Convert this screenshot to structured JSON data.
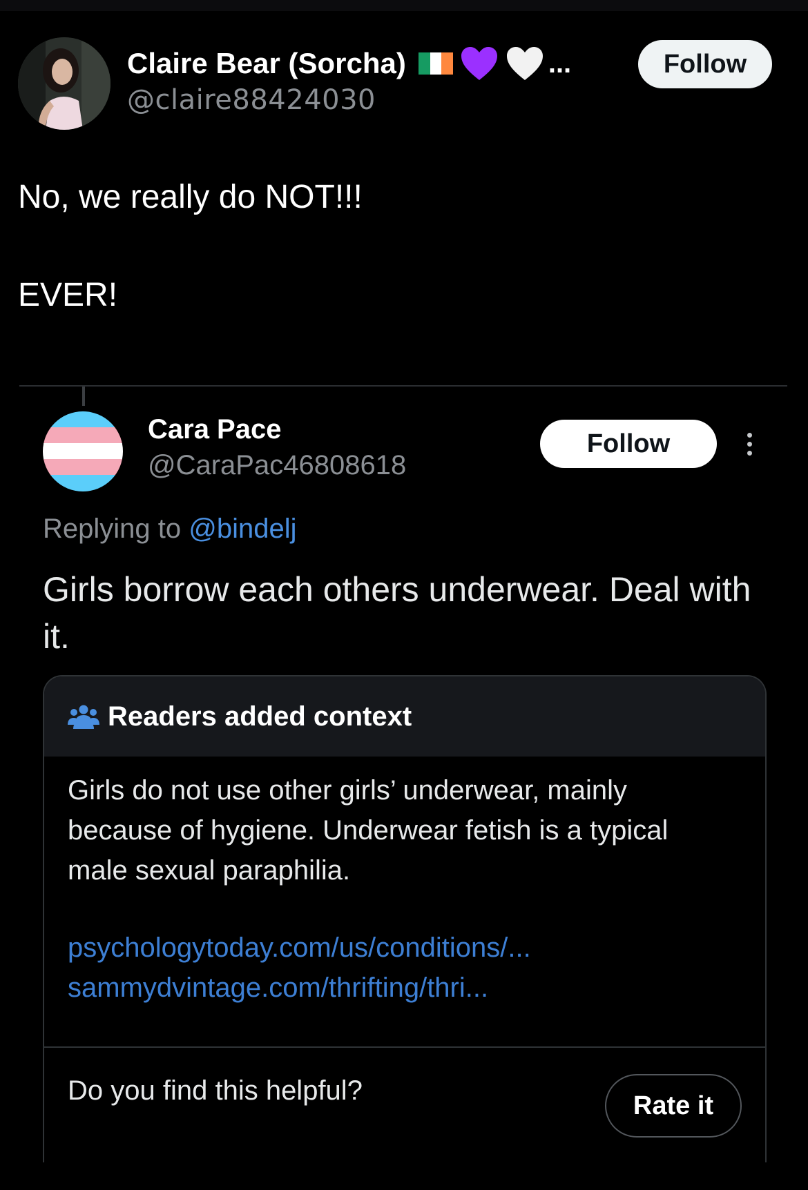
{
  "colors": {
    "background": "#000000",
    "link": "#4a8fe0",
    "secondary_text": "#8b8f94",
    "note_header_bg": "#16181c",
    "heart_purple": "#9b30ff",
    "heart_white": "#f2f2f2",
    "flag_green": "#169b62",
    "flag_white": "#ffffff",
    "flag_orange": "#ff883e"
  },
  "tweet": {
    "author": {
      "display_name": "Claire Bear (Sorcha)",
      "name_suffix": "...",
      "handle": "@claire88424030",
      "badges": [
        "ireland-flag-icon",
        "purple-heart-icon",
        "white-heart-icon"
      ]
    },
    "follow_label": "Follow",
    "text_line1": "No, we really do NOT!!!",
    "text_line2": "EVER!"
  },
  "quoted_tweet": {
    "author": {
      "display_name": "Cara Pace",
      "handle": "@CaraPac46808618",
      "avatar": "transgender-flag-avatar"
    },
    "follow_label": "Follow",
    "replying_prefix": "Replying to",
    "replying_handle": "@bindelj",
    "text": "Girls borrow each others underwear. Deal with it."
  },
  "community_note": {
    "header_icon": "people-icon",
    "title": "Readers added context",
    "body": "Girls do not use other girls’ underwear, mainly because of hygiene. Underwear fetish is a typical male sexual paraphilia.",
    "links": [
      "psychologytoday.com/us/conditions/...",
      "sammydvintage.com/thrifting/thri..."
    ],
    "question": "Do you find this helpful?",
    "rate_label": "Rate it"
  }
}
